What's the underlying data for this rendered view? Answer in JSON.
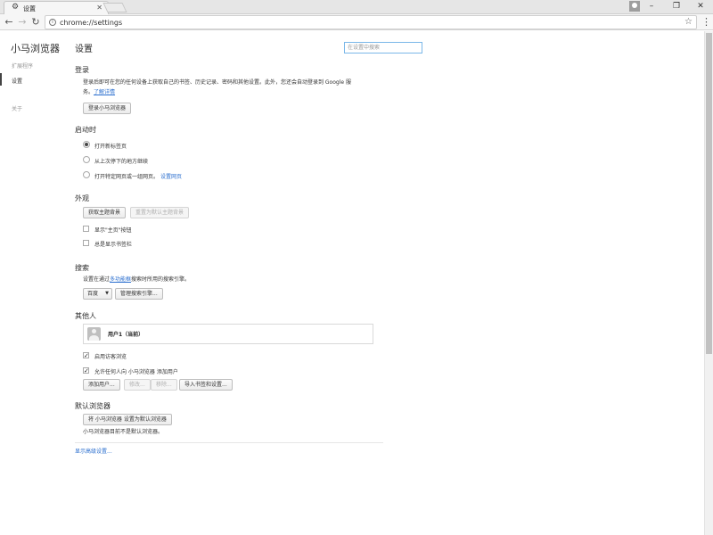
{
  "window": {
    "tab_title": "设置",
    "tab_icon": "gear-icon",
    "address": "chrome://settings",
    "controls": {
      "minimize": "–",
      "restore": "❐",
      "close": "✕"
    }
  },
  "sidebar": {
    "brand": "小马浏览器",
    "items": [
      {
        "label": "扩展程序",
        "active": false
      },
      {
        "label": "设置",
        "active": true
      },
      {
        "label": "关于",
        "active": false
      }
    ]
  },
  "main": {
    "title": "设置",
    "search_placeholder": "在设置中搜索"
  },
  "signin": {
    "title": "登录",
    "desc_line1": "登录后即可在您的任何设备上获取自己的书签、历史记录、密码和其他设置。此外，您还会自动登录到 Google 服",
    "desc_line2": "务。",
    "learn_more": "了解详情",
    "button": "登录小马浏览器"
  },
  "startup": {
    "title": "启动时",
    "options": [
      {
        "label": "打开新标签页",
        "selected": true
      },
      {
        "label": "从上次停下的地方继续",
        "selected": false
      },
      {
        "label": "打开特定网页或一组网页。",
        "selected": false
      }
    ],
    "set_pages_link": "设置网页"
  },
  "appearance": {
    "title": "外观",
    "get_themes": "获取主题背景",
    "reset_theme": "重置为默认主题背景",
    "show_home": {
      "label": "显示\"主页\"按钮",
      "checked": false
    },
    "show_bookmarks": {
      "label": "总是显示书签栏",
      "checked": false
    }
  },
  "search": {
    "title": "搜索",
    "desc_before": "设置在通过",
    "desc_link": "多功能框",
    "desc_after": "搜索时所用的搜索引擎。",
    "engine": "百度",
    "manage": "管理搜索引擎..."
  },
  "people": {
    "title": "其他人",
    "current_user": "用户1（当前）",
    "guest": {
      "label": "启用访客浏览",
      "checked": true
    },
    "allow_add": {
      "label": "允许任何人向 小马浏览器 添加用户",
      "checked": true
    },
    "buttons": {
      "add": "添加用户...",
      "edit": "修改...",
      "remove": "移除...",
      "import": "导入书签和设置..."
    }
  },
  "default_browser": {
    "title": "默认浏览器",
    "button": "将 小马浏览器 设置为默认浏览器",
    "status": "小马浏览器目前不是默认浏览器。"
  },
  "advanced_link": "显示高级设置..."
}
